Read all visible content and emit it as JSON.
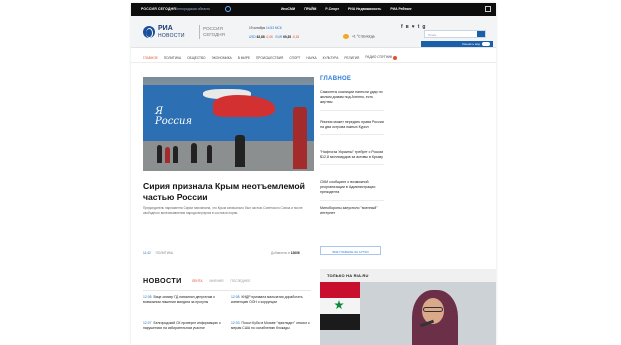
{
  "topbar": {
    "brand": "РОССИЯ СЕГОДНЯ",
    "region": "Белгородская область",
    "links": [
      "ИнoСМИ",
      "ПРАЙМ",
      "Р-Спорт",
      "РИА Недвижимость",
      "РИА Рейтинг"
    ]
  },
  "header": {
    "logo_ria": "РИА",
    "logo_novosti": "НОВОСТИ",
    "logo_rossia_1": "РОССИЯ",
    "logo_rossia_2": "СЕГОДНЯ",
    "date": "19 октября",
    "time": "14:53 МСК",
    "rate_usd_label": "USD",
    "rate_usd": "62,88",
    "rate_usd_change": "-0,06",
    "rate_eur_label": "EUR",
    "rate_eur": "69,35",
    "rate_eur_change": "-0,15",
    "weather_temp": "+1 °С",
    "weather_city": "Вологда",
    "social": [
      "f",
      "в",
      "♥",
      "t",
      "g"
    ],
    "search_placeholder": "Поиск",
    "right_label": "Сменить вид"
  },
  "nav": {
    "items": [
      "ГЛАВНОЕ",
      "ПОЛИТИКА",
      "ОБЩЕСТВО",
      "ЭКОНОМИКА",
      "В МИРЕ",
      "ПРОИСШЕСТВИЯ",
      "СПОРТ",
      "НАУКА",
      "КУЛЬТУРА",
      "РЕЛИГИЯ"
    ],
    "live": "РАДИО СПУТНИК"
  },
  "hero": {
    "mural_line1": "Я",
    "mural_line2": "Россия",
    "title": "Сирия признала Крым неотъемлемой частью России",
    "lead": "Председатель парламента Сирии напомнила, что Крым изначально был частью Советского Союза и после свободного волеизъявления народа вернулся в состав истории.",
    "time": "11:42",
    "section": "ПОЛИТИКА",
    "shares_label": "Добавлено в",
    "shares_count": "12606"
  },
  "main_column": {
    "title": "ГЛАВНОЕ",
    "items": [
      "Самолеты коалиции нанесли удар по жилым домам под Алеппо, есть жертвы",
      "Япония может передать права России на два острова южных Курил",
      "\"Нафтогаз Украины\" требует с России $12,8 миллиардов за активы в Крыму",
      "СМИ сообщают о возможной реорганизации в Администрации президента",
      "Минобороны запустило \"военный\" интернет"
    ],
    "all_button": "ВСЕ ГЛАВНОЕ ЗА СУТКИ"
  },
  "news": {
    "title": "НОВОСТИ",
    "tabs": [
      "ЛЕНТА",
      "МНЕНИЯ",
      "ПОСЛЕДНЕЕ"
    ],
    "items": [
      {
        "time": "12:08",
        "text": "Вице-спикер ГД напомнил депутатам о возможном лишении мандата за прогулы"
      },
      {
        "time": "12:08",
        "text": "КНДР призвала мальчатия доработать конвенцию ООН о коррупции"
      },
      {
        "time": "12:07",
        "text": "Белгородский СК проверит информацию о нарушениях на избирательном участке"
      },
      {
        "time": "12:03",
        "text": "Посол Кубы в Москве \"приглядит\" отмосл к мерам США по ослаблению блокады"
      }
    ]
  },
  "only_ria": {
    "title": "ТОЛЬКО НА RIA.RU"
  }
}
